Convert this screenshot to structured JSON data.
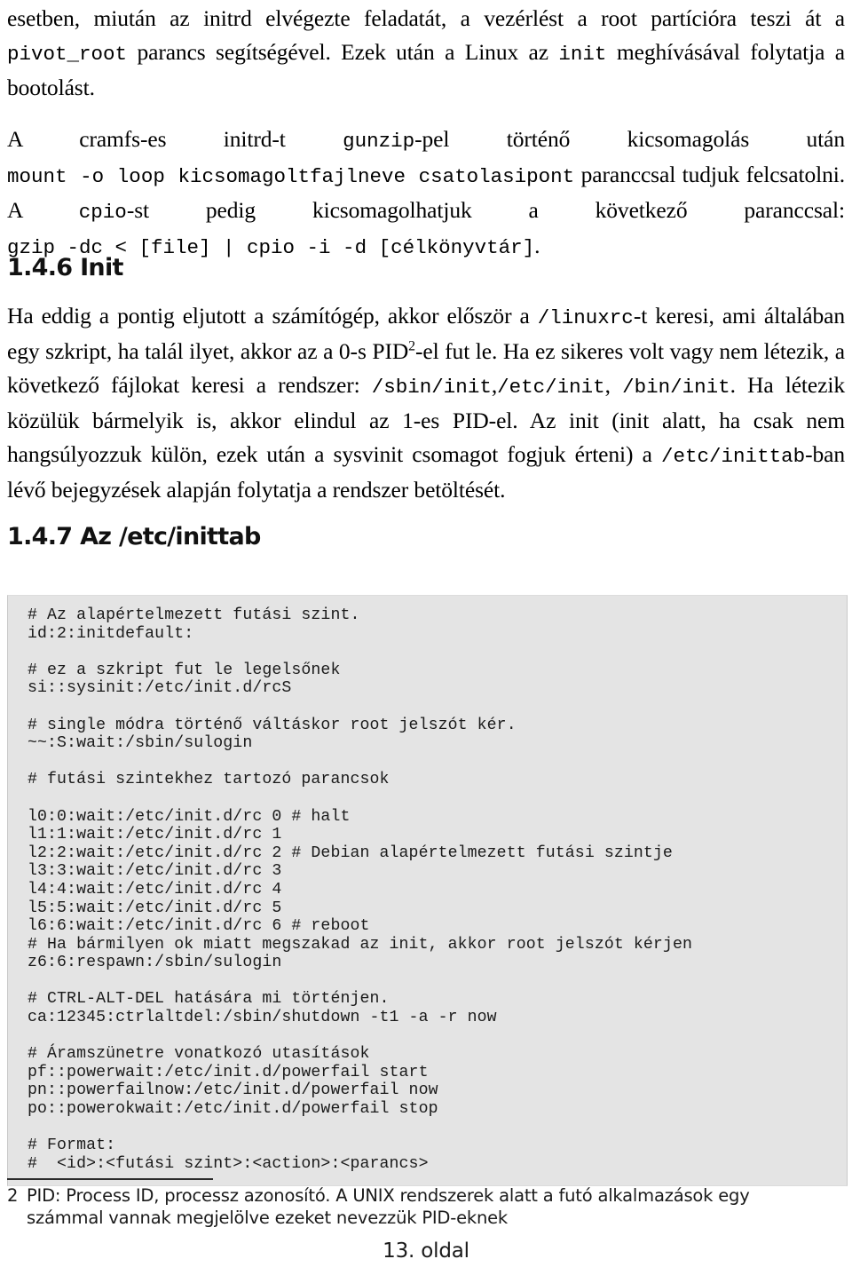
{
  "document": {
    "language": "hu",
    "page_number_label": "13. oldal"
  },
  "intro_paragraphs": [
    {
      "id": "p1",
      "segments": [
        {
          "type": "text",
          "text": "esetben, miután az initrd elvégezte feladatát, a vezérlést a root partícióra teszi át a "
        },
        {
          "type": "code",
          "text": "pivot_root"
        },
        {
          "type": "text",
          "text": " parancs segítségével. Ezek után a Linux az "
        },
        {
          "type": "code",
          "text": "init"
        },
        {
          "type": "text",
          "text": " meghívásával folytatja a bootolást."
        }
      ],
      "plain": "esetben, miután az initrd elvégezte feladatát, a vezérlést a root partícióra teszi át a pivot_root parancs segítségével. Ezek után a Linux az init meghívásával folytatja a bootolást."
    },
    {
      "id": "p2",
      "segments": [
        {
          "type": "text",
          "text": "A cramfs-es initrd-t "
        },
        {
          "type": "code",
          "text": "gunzip"
        },
        {
          "type": "text",
          "text": "-pel történő kicsomagolás után "
        },
        {
          "type": "code",
          "text": "mount -o loop kicsomagoltfajlneve csatolasipont"
        },
        {
          "type": "text",
          "text": " paranccsal tudjuk felcsatolni. A "
        },
        {
          "type": "code",
          "text": "cpio"
        },
        {
          "type": "text",
          "text": "-st pedig kicsomagolhatjuk a következő paranccsal: "
        },
        {
          "type": "code",
          "text": "gzip -dc < [file] | cpio -i -d [célkönyvtár]"
        },
        {
          "type": "text",
          "text": "."
        }
      ],
      "plain": "A cramfs-es initrd-t gunzip-pel történő kicsomagolás után mount -o loop kicsomagoltfajlneve csatolasipont paranccsal tudjuk felcsatolni. A cpio-st pedig kicsomagolhatjuk a következő paranccsal: gzip -dc < [file] | cpio -i -d [célkönyvtár]."
    }
  ],
  "sections": [
    {
      "id": "1.4.6",
      "heading": "1.4.6 Init",
      "body_plain": "Ha eddig a pontig eljutott a számítógép, akkor először a /linuxrc-t keresi, ami általában egy szkript, ha talál ilyet, akkor az a 0-s PID2-el fut le. Ha ez sikeres volt vagy nem létezik, a következő fájlokat keresi a rendszer: /sbin/init, /etc/init, /bin/init. Ha létezik közülük bármelyik is, akkor elindul az 1-es PID-el. Az init (init alatt, ha csak nem hangsúlyozzuk külön, ezek után a sysvinit csomagot fogjuk érteni) a /etc/inittab-ban lévő bejegyzések alapján folytatja a rendszer betöltését.",
      "text_parts": {
        "t1": "Ha eddig a pontig eljutott a számítógép, akkor először a ",
        "c1": "/linuxrc",
        "t2": "-t keresi, ami általában egy szkript, ha talál ilyet, akkor az a 0-s PID",
        "sup1": "2",
        "t3": "-el fut le. Ha ez sikeres volt vagy nem létezik, a következő fájlokat keresi a rendszer: ",
        "c2": "/sbin/init",
        "t4": ",",
        "c3": "/etc/init",
        "t5": ", ",
        "c4": "/bin/init",
        "t6": ". Ha létezik közülük bármelyik is, akkor elindul az 1-es PID-el. Az init (init alatt, ha csak nem hangsúlyozzuk külön, ezek után a sysvinit csomagot fogjuk érteni) a ",
        "c5": "/etc/inittab",
        "t7": "-ban lévő bejegyzések alapján folytatja a rendszer betöltését."
      }
    },
    {
      "id": "1.4.7",
      "heading": "1.4.7 Az /etc/inittab"
    }
  ],
  "code_block": {
    "language": "inittab",
    "background_color": "#e4e4e4",
    "lines": [
      "# Az alapértelmezett futási szint.",
      "id:2:initdefault:",
      "",
      "# ez a szkript fut le legelsőnek",
      "si::sysinit:/etc/init.d/rcS",
      "",
      "# single módra történő váltáskor root jelszót kér.",
      "~~:S:wait:/sbin/sulogin",
      "",
      "# futási szintekhez tartozó parancsok",
      "",
      "l0:0:wait:/etc/init.d/rc 0 # halt",
      "l1:1:wait:/etc/init.d/rc 1",
      "l2:2:wait:/etc/init.d/rc 2 # Debian alapértelmezett futási szintje",
      "l3:3:wait:/etc/init.d/rc 3",
      "l4:4:wait:/etc/init.d/rc 4",
      "l5:5:wait:/etc/init.d/rc 5",
      "l6:6:wait:/etc/init.d/rc 6 # reboot",
      "# Ha bármilyen ok miatt megszakad az init, akkor root jelszót kérjen",
      "z6:6:respawn:/sbin/sulogin",
      "",
      "# CTRL-ALT-DEL hatására mi történjen.",
      "ca:12345:ctrlaltdel:/sbin/shutdown -t1 -a -r now",
      "",
      "# Áramszünetre vonatkozó utasítások",
      "pf::powerwait:/etc/init.d/powerfail start",
      "pn::powerfailnow:/etc/init.d/powerfail now",
      "po::powerokwait:/etc/init.d/powerfail stop",
      "",
      "# Format:",
      "#  <id>:<futási szint>:<action>:<parancs>"
    ],
    "text": "# Az alapértelmezett futási szint.\nid:2:initdefault:\n\n# ez a szkript fut le legelsőnek\nsi::sysinit:/etc/init.d/rcS\n\n# single módra történő váltáskor root jelszót kér.\n~~:S:wait:/sbin/sulogin\n\n# futási szintekhez tartozó parancsok\n\nl0:0:wait:/etc/init.d/rc 0 # halt\nl1:1:wait:/etc/init.d/rc 1\nl2:2:wait:/etc/init.d/rc 2 # Debian alapértelmezett futási szintje\nl3:3:wait:/etc/init.d/rc 3\nl4:4:wait:/etc/init.d/rc 4\nl5:5:wait:/etc/init.d/rc 5\nl6:6:wait:/etc/init.d/rc 6 # reboot\n# Ha bármilyen ok miatt megszakad az init, akkor root jelszót kérjen\nz6:6:respawn:/sbin/sulogin\n\n# CTRL-ALT-DEL hatására mi történjen.\nca:12345:ctrlaltdel:/sbin/shutdown -t1 -a -r now\n\n# Áramszünetre vonatkozó utasítások\npf::powerwait:/etc/init.d/powerfail start\npn::powerfailnow:/etc/init.d/powerfail now\npo::powerokwait:/etc/init.d/powerfail stop\n\n# Format:\n#  <id>:<futási szint>:<action>:<parancs>"
  },
  "footnote": {
    "number": "2",
    "line1": "PID: Process ID, processz azonosító. A UNIX rendszerek alatt a futó alkalmazások egy",
    "line2": "számmal vannak megjelölve ezeket nevezzük PID-eknek",
    "full": "2 PID: Process ID, processz azonosító. A UNIX rendszerek alatt a futó alkalmazások egy számmal vannak megjelölve ezeket nevezzük PID-eknek"
  }
}
